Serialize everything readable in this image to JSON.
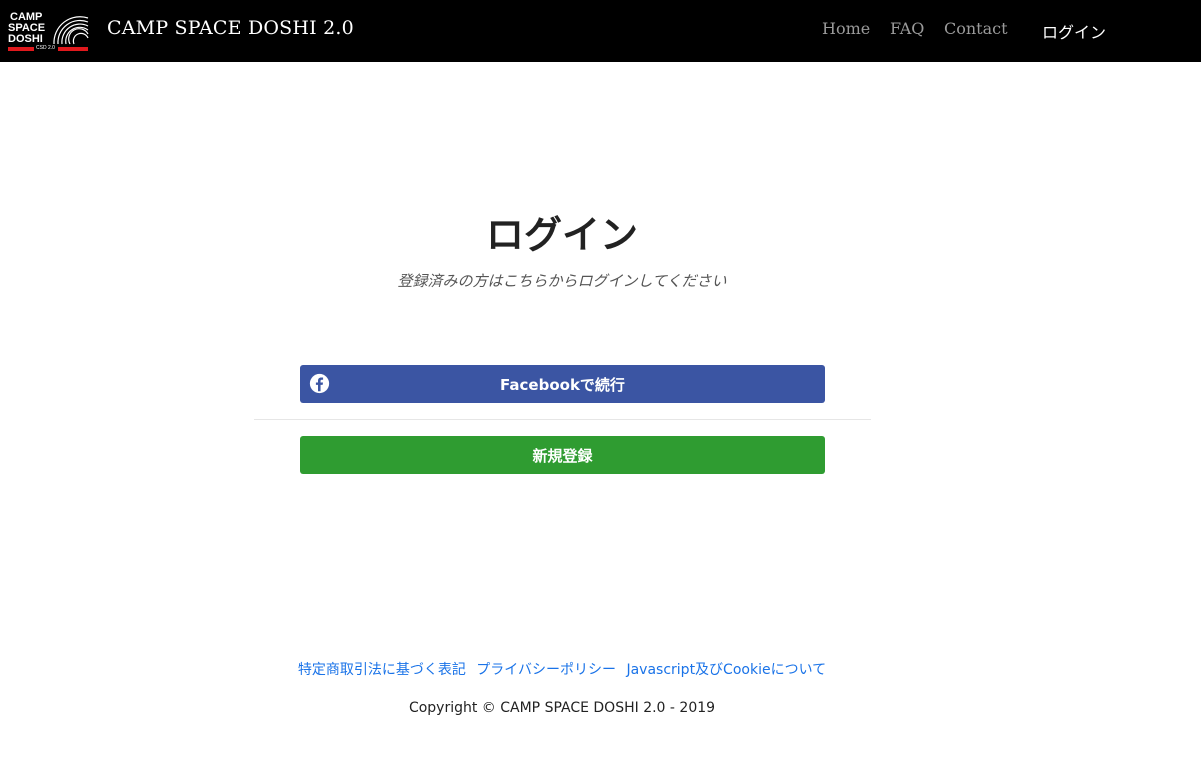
{
  "header": {
    "logo": {
      "line1": "CAMP",
      "line2": "SPACE",
      "line3": "DOSHI",
      "tag": "CSD 2.0"
    },
    "brand": "CAMP SPACE DOSHI 2.0",
    "nav": {
      "home": "Home",
      "faq": "FAQ",
      "contact": "Contact",
      "login": "ログイン"
    }
  },
  "main": {
    "title": "ログイン",
    "subtitle": "登録済みの方はこちらからログインしてください",
    "facebook_button": "Facebookで続行",
    "signup_button": "新規登録"
  },
  "footer": {
    "links": [
      "特定商取引法に基づく表記",
      "プライバシーポリシー",
      "Javascript及びCookieについて"
    ],
    "copyright": "Copyright © CAMP SPACE DOSHI 2.0 - 2019"
  },
  "colors": {
    "header_bg": "#000000",
    "facebook_blue": "#3b55a3",
    "signup_green": "#2f9c31",
    "link_blue": "#1a73e8",
    "logo_red": "#e0191d"
  }
}
